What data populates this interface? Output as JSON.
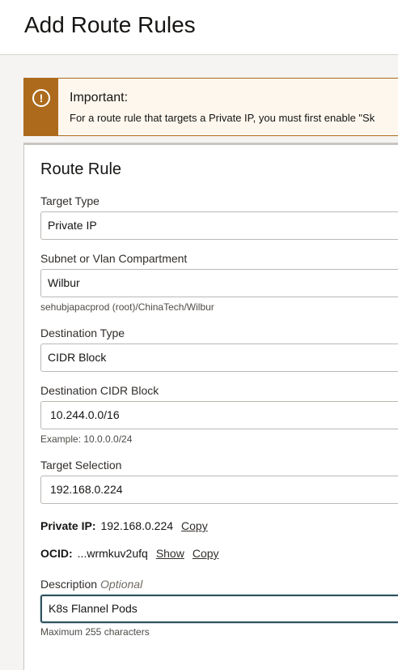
{
  "header": {
    "title": "Add Route Rules"
  },
  "alert": {
    "icon": "exclamation-circle-icon",
    "title": "Important:",
    "body": "For a route rule that targets a Private IP, you must first enable \"Sk"
  },
  "rule": {
    "title": "Route Rule",
    "target_type": {
      "label": "Target Type",
      "value": "Private IP"
    },
    "compartment": {
      "label": "Subnet or Vlan Compartment",
      "value": "Wilbur",
      "path": "sehubjapacprod (root)/ChinaTech/Wilbur"
    },
    "destination_type": {
      "label": "Destination Type",
      "value": "CIDR Block"
    },
    "destination_cidr": {
      "label": "Destination CIDR Block",
      "value": "10.244.0.0/16",
      "example": "Example: 10.0.0.0/24"
    },
    "target_selection": {
      "label": "Target Selection",
      "value": "192.168.0.224"
    },
    "private_ip": {
      "label": "Private IP:",
      "value": "192.168.0.224",
      "copy": "Copy"
    },
    "ocid": {
      "label": "OCID:",
      "value": "...wrmkuv2ufq",
      "show": "Show",
      "copy": "Copy"
    },
    "description": {
      "label": "Description",
      "optional": "Optional",
      "value": "K8s Flannel Pods",
      "hint": "Maximum 255 characters"
    }
  },
  "colors": {
    "warning": "#ad6a1d",
    "focus": "#30525e",
    "background": "#f5f4f2"
  }
}
